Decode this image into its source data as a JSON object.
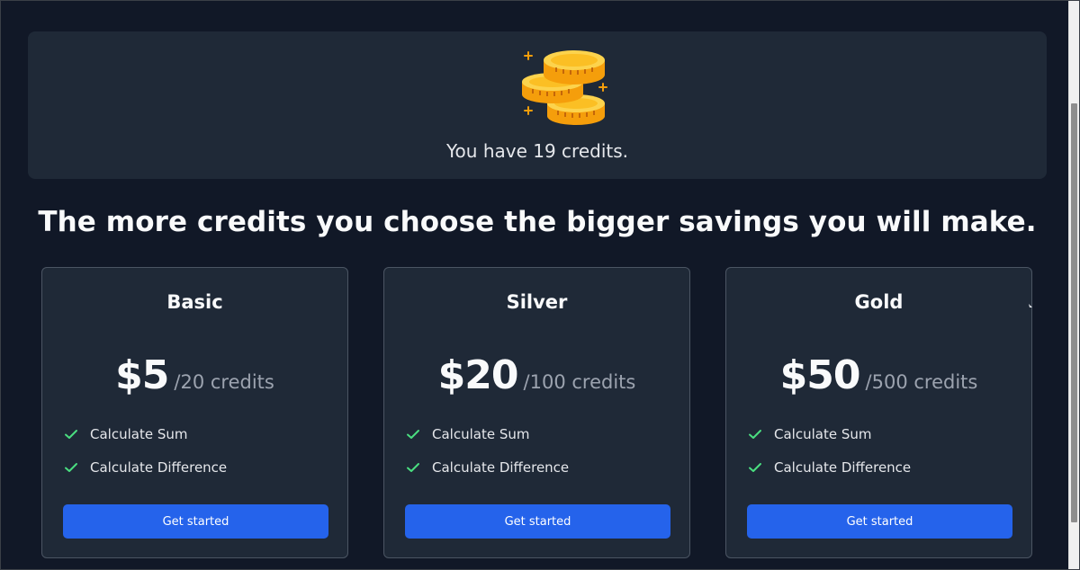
{
  "hero": {
    "credits_text": "You have 19 credits."
  },
  "headline": "The more credits you choose the bigger savings you will make.",
  "plans": [
    {
      "name": "Basic",
      "price": "$5",
      "per": "/20 credits",
      "features": [
        "Calculate Sum",
        "Calculate Difference"
      ],
      "cta": "Get started"
    },
    {
      "name": "Silver",
      "price": "$20",
      "per": "/100 credits",
      "features": [
        "Calculate Sum",
        "Calculate Difference"
      ],
      "cta": "Get started"
    },
    {
      "name": "Gold",
      "price": "$50",
      "per": "/500 credits",
      "features": [
        "Calculate Sum",
        "Calculate Difference"
      ],
      "cta": "Get started"
    }
  ],
  "colors": {
    "page_bg": "#111827",
    "card_bg": "#1f2937",
    "accent_button": "#2563eb",
    "check": "#4ade80",
    "coin": "#fbbf24"
  },
  "icons": {
    "hero": "coins-icon",
    "feature": "check-icon"
  }
}
